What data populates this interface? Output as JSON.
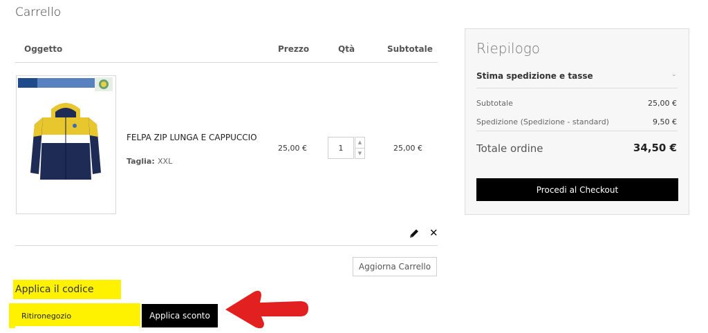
{
  "page": {
    "title": "Carrello"
  },
  "cart": {
    "headers": {
      "item": "Oggetto",
      "price": "Prezzo",
      "qty": "Qtà",
      "subtotal": "Subtotale"
    },
    "items": [
      {
        "name": "FELPA ZIP LUNGA E CAPPUCCIO",
        "option_label": "Taglia:",
        "option_value": "XXL",
        "price": "25,00 €",
        "qty": "1",
        "subtotal": "25,00 €"
      }
    ],
    "update_label": "Aggiorna Carrello"
  },
  "discount": {
    "title": "Applica il codice sconto",
    "code_value": "Ritironegozio",
    "apply_label": "Applica sconto",
    "highlight_color": "#fff200",
    "arrow_color": "#e32020"
  },
  "summary": {
    "title": "Riepilogo",
    "shipping_estimate_label": "Stima spedizione e tasse",
    "rows": [
      {
        "label": "Subtotale",
        "value": "25,00 €"
      },
      {
        "label": "Spedizione (Spedizione - standard)",
        "value": "9,50 €"
      }
    ],
    "total_label": "Totale ordine",
    "total_value": "34,50 €",
    "checkout_label": "Procedi al Checkout"
  }
}
